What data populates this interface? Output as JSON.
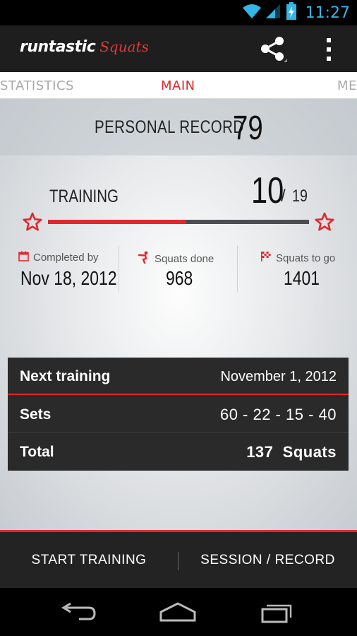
{
  "status_bar": {
    "time": "11:27",
    "icons": [
      "wifi-icon",
      "signal-icon",
      "battery-charging-icon"
    ]
  },
  "action_bar": {
    "logo_main": "runtastic",
    "logo_sub": "Squats",
    "actions": [
      "share-icon",
      "overflow-menu-icon"
    ]
  },
  "tabs": {
    "left": "STATISTICS",
    "center": "MAIN",
    "right": "ME"
  },
  "personal_record": {
    "label": "PERSONAL RECORD",
    "value": "79"
  },
  "training": {
    "label": "TRAINING",
    "current": "10",
    "separator": "/",
    "total": "19",
    "progress_fraction": 0.53
  },
  "stats": [
    {
      "icon": "calendar-icon",
      "label": "Completed by",
      "value": "Nov 18, 2012"
    },
    {
      "icon": "squat-figure-icon",
      "label": "Squats done",
      "value": "968"
    },
    {
      "icon": "finish-flag-icon",
      "label": "Squats to go",
      "value": "1401"
    }
  ],
  "next_table": {
    "rows": [
      {
        "key": "Next training",
        "value": "November 1, 2012"
      },
      {
        "key": "Sets",
        "value": "60 - 22 - 15 - 40"
      },
      {
        "key": "Total",
        "value_number": "137",
        "value_unit": "Squats"
      }
    ]
  },
  "buttons": {
    "start": "START TRAINING",
    "session": "SESSION / RECORD"
  },
  "nav": [
    "back-icon",
    "home-icon",
    "recent-apps-icon"
  ],
  "colors": {
    "accent": "#e0282e",
    "holo_blue": "#33b5e5",
    "dark": "#2a2a2b"
  }
}
